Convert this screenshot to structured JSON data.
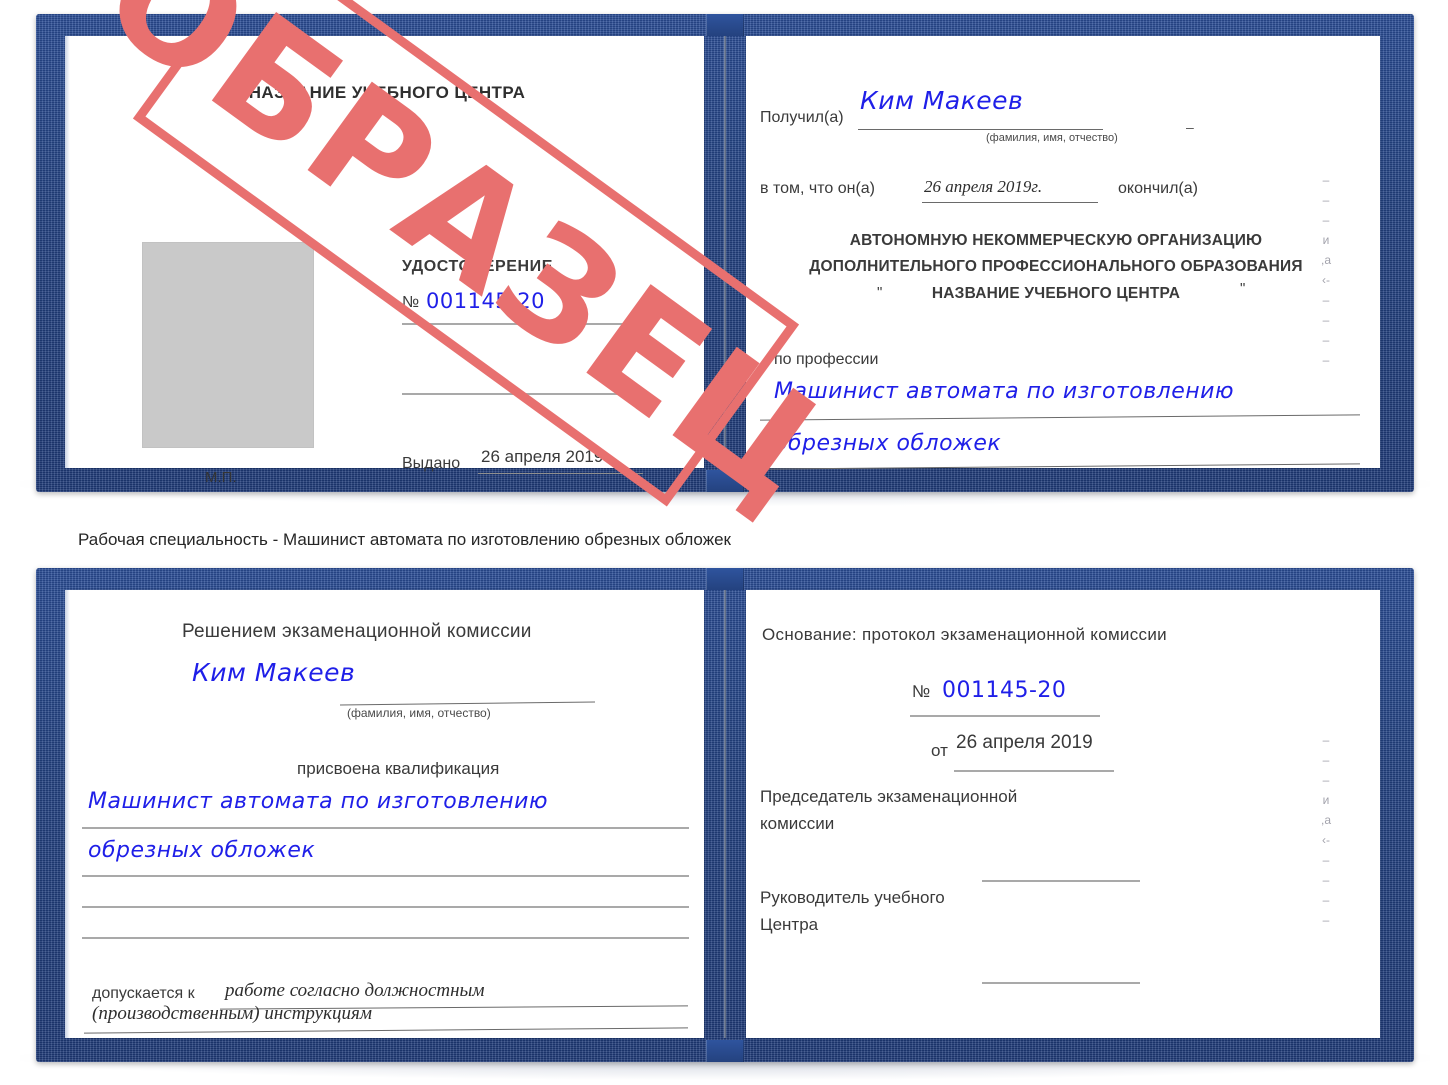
{
  "caption": "Рабочая специальность - Машинист автомата по изготовлению обрезных обложек",
  "watermark": {
    "label": "ОБРАЗЕЦ",
    "color": "#e8706f"
  },
  "theme": {
    "cover_blue": "#234282",
    "handwriting_blue": "#1f1fe8",
    "page_white": "#ffffff",
    "rule_gray": "#8f8f8f",
    "photo_placeholder_gray": "#c9c9c9"
  },
  "certificate_front": {
    "left_page": {
      "center_name": "НАЗВАНИЕ УЧЕБНОГО ЦЕНТРА",
      "doc_type": "УДОСТОВЕРЕНИЕ",
      "number_label": "№",
      "number_value": "001145-20",
      "issued_label": "Выдано",
      "issued_value": "26 апреля 2019",
      "seal_label": "М.П.",
      "photo_placeholder": "photo-placeholder"
    },
    "right_page": {
      "received_label": "Получил(а)",
      "received_value": "Ким Макеев",
      "fio_hint": "(фамилия, имя, отчество)",
      "that_label": "в том, что он(а)",
      "completed_date": "26 апреля 2019г.",
      "completed_label": "окончил(а)",
      "org_line1": "АВТОНОМНУЮ НЕКОММЕРЧЕСКУЮ ОРГАНИЗАЦИЮ",
      "org_line2": "ДОПОЛНИТЕЛЬНОГО ПРОФЕССИОНАЛЬНОГО ОБРАЗОВАНИЯ",
      "org_quote_open": "\"",
      "org_line3": "НАЗВАНИЕ УЧЕБНОГО ЦЕНТРА",
      "org_quote_close": "\"",
      "profession_label": "по профессии",
      "profession_line1": "Машинист автомата по изготовлению",
      "profession_line2": "обрезных обложек",
      "edge_bleed": "–\n–\n–\nи\n,а\n‹-\n–\n–\n–\n–"
    }
  },
  "certificate_back": {
    "left_page": {
      "heading": "Решением экзаменационной комиссии",
      "name_value": "Ким Макеев",
      "fio_hint": "(фамилия, имя, отчество)",
      "qualification_label": "присвоена квалификация",
      "qualification_line1": "Машинист автомата по изготовлению",
      "qualification_line2": "обрезных обложек",
      "allowed_label": "допускается к",
      "allowed_line1": "работе согласно должностным",
      "allowed_line2": "(производственным) инструкциям"
    },
    "right_page": {
      "basis_label": "Основание: протокол экзаменационной комиссии",
      "number_label": "№",
      "number_value": "001145-20",
      "date_label": "от",
      "date_value": "26 апреля 2019",
      "chair_line1": "Председатель экзаменационной",
      "chair_line2": "комиссии",
      "head_line1": "Руководитель учебного",
      "head_line2": "Центра",
      "edge_bleed": "–\n–\n–\nи\n,а\n‹-\n–\n–\n–\n–"
    }
  }
}
